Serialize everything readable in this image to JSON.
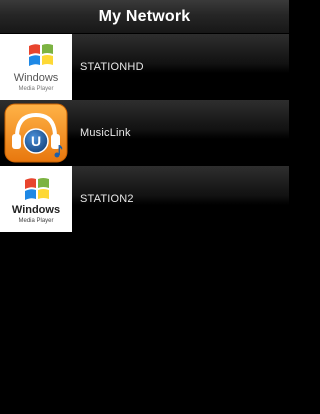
{
  "header": {
    "title": "My Network"
  },
  "devices": [
    {
      "label": "STATIONHD",
      "icon": "windows-media-player-icon",
      "icon_text": "Windows",
      "icon_subtext": "Media Player"
    },
    {
      "label": "MusicLink",
      "icon": "musiclink-headphones-icon",
      "icon_text": "U"
    },
    {
      "label": "STATION2",
      "icon": "windows-media-player-icon",
      "icon_text": "Windows",
      "icon_subtext": "Media Player"
    }
  ],
  "colors": {
    "background": "#000000",
    "header_text": "#ffffff",
    "row_text": "#e8e8e8",
    "musiclink_orange": "#f28c1c",
    "musiclink_blue": "#1e5fa8"
  }
}
